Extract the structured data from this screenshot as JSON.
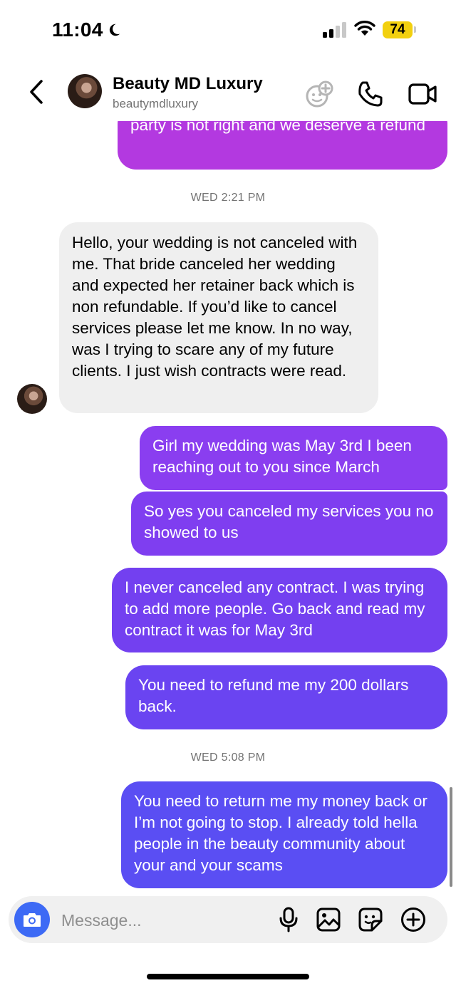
{
  "status_bar": {
    "time": "11:04",
    "battery": "74"
  },
  "header": {
    "name": "Beauty MD Luxury",
    "handle": "beautymdluxury"
  },
  "messages": [
    {
      "type": "out",
      "text": "party is not right and we deserve a refund"
    },
    {
      "type": "timestamp",
      "text": "WED 2:21 PM"
    },
    {
      "type": "in",
      "text": "Hello, your wedding is not canceled with me. That bride canceled her wedding and expected her retainer back which is non refundable. If you’d like to cancel services please let me know. In no way, was I trying to scare any of my future clients. I just wish contracts were read."
    },
    {
      "type": "out",
      "text": "Girl my wedding was May 3rd I been reaching out to you since March"
    },
    {
      "type": "out",
      "text": "So yes you canceled my services you no showed to us"
    },
    {
      "type": "out",
      "text": "I never canceled any contract. I was trying to add more people. Go back and read my contract it was for May 3rd"
    },
    {
      "type": "out",
      "text": "You need to refund me my 200 dollars back."
    },
    {
      "type": "timestamp",
      "text": "WED 5:08 PM"
    },
    {
      "type": "out",
      "text": "You need to return me my money back or I’m not going to stop.  I already told hella people in the beauty community about your and your scams"
    }
  ],
  "composer": {
    "placeholder": "Message..."
  },
  "colors": {
    "bubble_purple": "#b339e0",
    "bubble_violet": "#7a3ef0",
    "bubble_blue": "#5a4ef3",
    "incoming": "#efefef",
    "camera_button": "#3d6af5"
  },
  "icons": [
    "moon-icon",
    "signal-icon",
    "wifi-icon",
    "back-chevron-icon",
    "effects-icon",
    "phone-icon",
    "video-icon",
    "camera-icon",
    "microphone-icon",
    "gallery-icon",
    "sticker-icon",
    "plus-icon"
  ]
}
